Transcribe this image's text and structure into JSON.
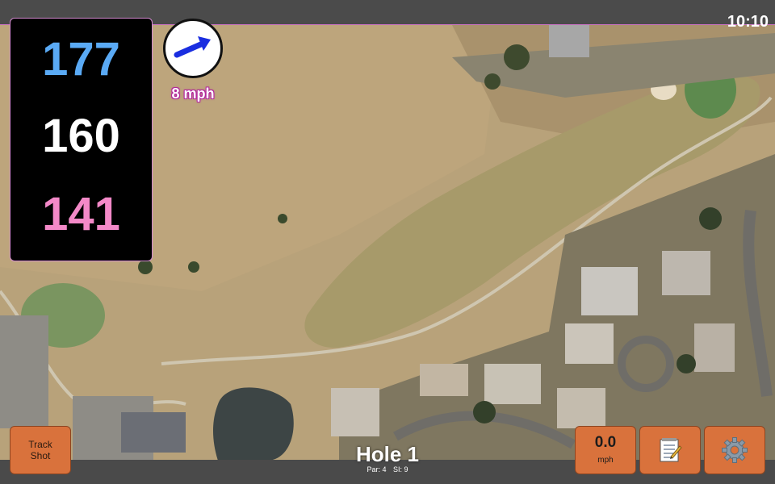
{
  "status": {
    "time": "10:10"
  },
  "distances": {
    "back": "177",
    "middle": "160",
    "front": "141"
  },
  "wind": {
    "speed": "8 mph",
    "direction_icon": "arrow-east-northeast-icon"
  },
  "hole": {
    "title": "Hole 1",
    "par": "Par: 4",
    "si": "SI: 9"
  },
  "buttons": {
    "track_shot": {
      "line1": "Track",
      "line2": "Shot"
    },
    "speed": {
      "value": "0.0",
      "unit": "mph"
    },
    "notes_icon": "notepad-icon",
    "settings_icon": "gear-icon"
  },
  "colors": {
    "back_distance": "#5aaaf5",
    "middle_distance": "#ffffff",
    "front_distance": "#f389c8",
    "button_orange": "#d9723c",
    "accent_magenta": "#c56fc0"
  }
}
